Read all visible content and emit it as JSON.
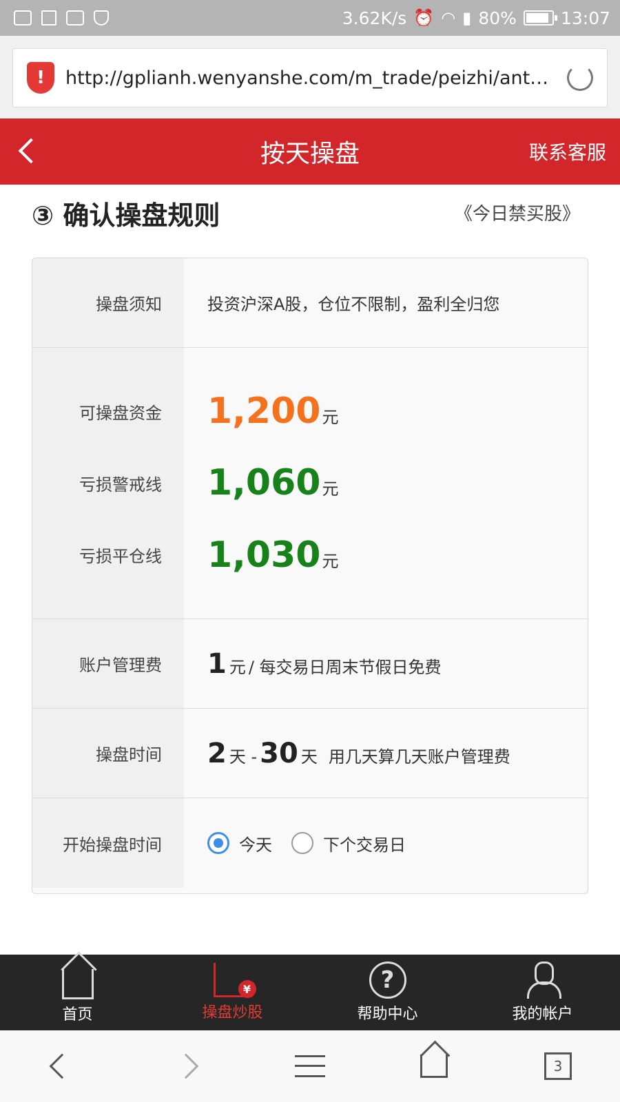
{
  "status_bar": {
    "speed": "3.62K/s",
    "battery": "80%",
    "time": "13:07"
  },
  "browser": {
    "url": "http://gplianh.wenyanshe.com/m_trade/peizhi/ant…"
  },
  "header": {
    "title": "按天操盘",
    "service_link": "联系客服"
  },
  "section": {
    "title": "③ 确认操盘规则",
    "link": "《今日禁买股》"
  },
  "rules": {
    "notice_label": "操盘须知",
    "notice_value": "投资沪深A股，仓位不限制，盈利全归您",
    "funds_label": "可操盘资金",
    "funds_value": "1,200",
    "warning_label": "亏损警戒线",
    "warning_value": "1,060",
    "liquidation_label": "亏损平仓线",
    "liquidation_value": "1,030",
    "unit": "元",
    "fee_label": "账户管理费",
    "fee_value": "1",
    "fee_desc": "/ 每交易日周末节假日免费",
    "period_label": "操盘时间",
    "period_min": "2",
    "period_sep": "天 -",
    "period_max": "30",
    "period_unit": "天",
    "period_desc": "用几天算几天账户管理费",
    "start_label": "开始操盘时间",
    "start_options": [
      {
        "label": "今天",
        "selected": true
      },
      {
        "label": "下个交易日",
        "selected": false
      }
    ]
  },
  "tabbar": {
    "items": [
      {
        "label": "首页",
        "icon": "home-icon",
        "active": false
      },
      {
        "label": "操盘炒股",
        "icon": "trade-chart-icon",
        "active": true
      },
      {
        "label": "帮助中心",
        "icon": "help-icon",
        "active": false
      },
      {
        "label": "我的帐户",
        "icon": "user-icon",
        "active": false
      }
    ]
  },
  "navbar": {
    "tab_count": "3"
  },
  "colors": {
    "brand_red": "#d3262b",
    "orange": "#f4721e",
    "green": "#17811a",
    "radio_blue": "#3b8fe8"
  }
}
